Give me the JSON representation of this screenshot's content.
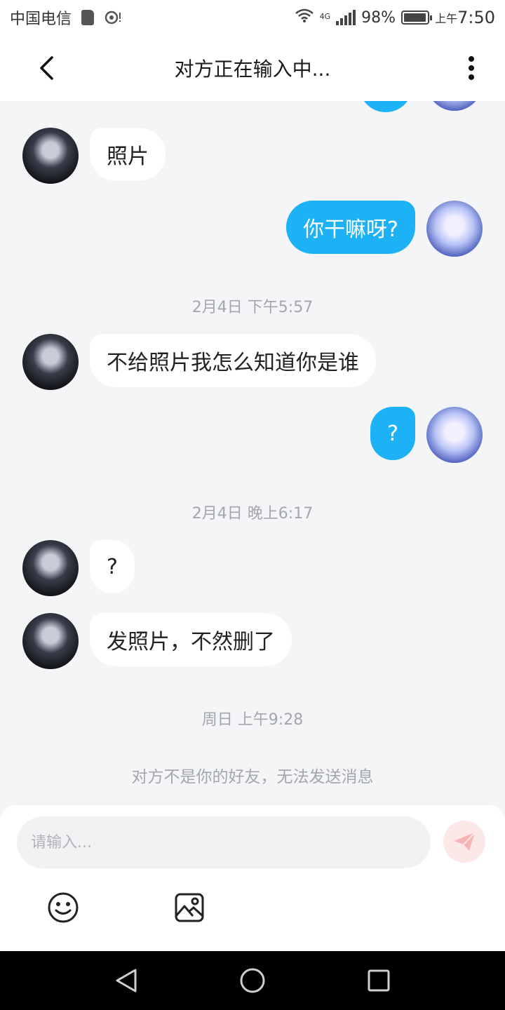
{
  "status_bar": {
    "carrier": "中国电信",
    "network": "4G",
    "battery": "98%",
    "battery_level": 0.98,
    "time_period": "上午",
    "time": "7:50",
    "icons": [
      "sd-card-icon",
      "cast-icon",
      "wifi-icon",
      "signal-icon",
      "battery-icon"
    ]
  },
  "header": {
    "title": "对方正在输入中...",
    "back_icon": "chevron-left-icon",
    "more_icon": "more-vertical-icon"
  },
  "messages": [
    {
      "from": "peer",
      "text": "照片"
    },
    {
      "from": "me",
      "text": "你干嘛呀?"
    },
    {
      "type": "timestamp",
      "text": "2月4日 下午5:57"
    },
    {
      "from": "peer",
      "text": "不给照片我怎么知道你是谁"
    },
    {
      "from": "me",
      "text": "?"
    },
    {
      "type": "timestamp",
      "text": "2月4日 晚上6:17"
    },
    {
      "from": "peer",
      "text": "?"
    },
    {
      "from": "peer",
      "text": "发照片，不然删了"
    },
    {
      "type": "timestamp",
      "text": "周日 上午9:28"
    }
  ],
  "system_notice": "对方不是你的好友，无法发送消息",
  "composer": {
    "placeholder": "请输入...",
    "send_icon": "send-icon",
    "tools": [
      "emoji-icon",
      "image-icon"
    ]
  },
  "nav_bar": {
    "buttons": [
      "back-triangle-icon",
      "home-circle-icon",
      "recents-square-icon"
    ]
  },
  "colors": {
    "my_bubble": "#1db2f5",
    "peer_bubble": "#ffffff",
    "chat_background": "#f4f5f7",
    "timestamp_text": "#a3a6ad",
    "send_button_bg": "#fde8e8"
  }
}
